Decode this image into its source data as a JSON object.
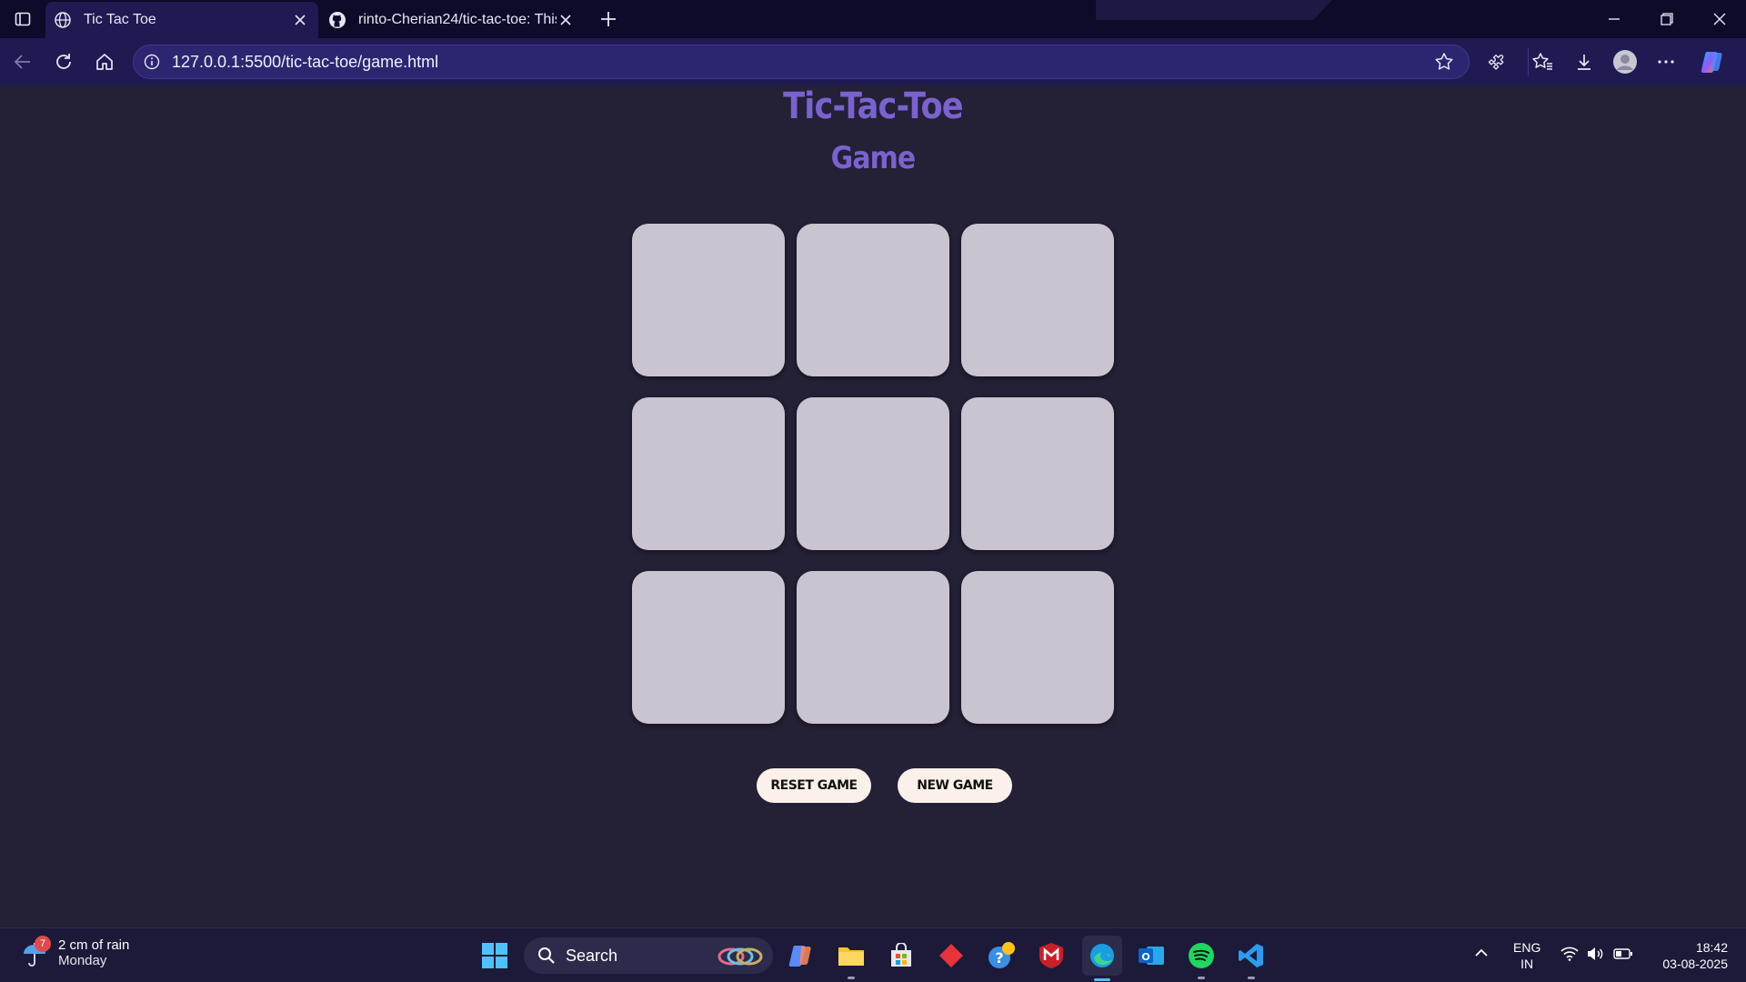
{
  "browser": {
    "tabs": [
      {
        "title": "Tic Tac Toe",
        "active": true,
        "icon": "globe-icon"
      },
      {
        "title": "rinto-Cherian24/tic-tac-toe: This i",
        "active": false,
        "icon": "github-icon"
      }
    ],
    "url": "127.0.0.1:5500/tic-tac-toe/game.html",
    "accent": "#1f1a52"
  },
  "page": {
    "title": "Tic-Tac-Toe",
    "subtitle": "Game",
    "title_color": "#7a62cf",
    "board": {
      "cells": [
        "",
        "",
        "",
        "",
        "",
        "",
        "",
        "",
        ""
      ],
      "cell_color": "#cac4d1"
    },
    "buttons": {
      "reset_label": "RESET GAME",
      "new_label": "NEW GAME"
    }
  },
  "taskbar": {
    "weather": {
      "badge": "7",
      "line1": "2 cm of rain",
      "line2": "Monday"
    },
    "search_placeholder": "Search",
    "language": {
      "line1": "ENG",
      "line2": "IN"
    },
    "clock": {
      "time": "18:42",
      "date": "03-08-2025"
    }
  }
}
